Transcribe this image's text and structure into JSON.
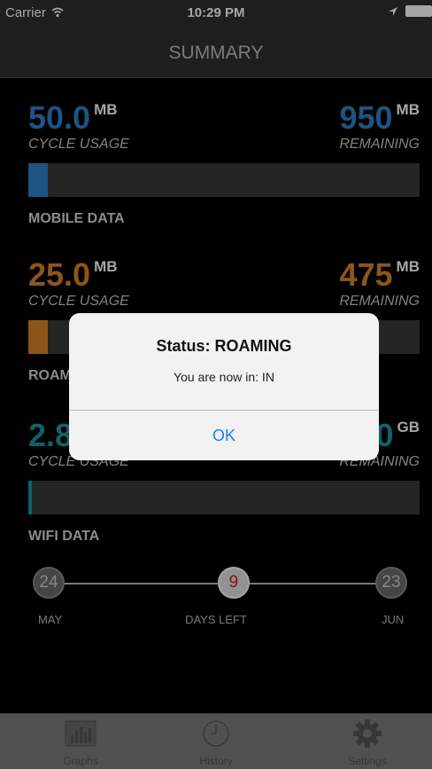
{
  "status_bar": {
    "carrier": "Carrier",
    "time": "10:29 PM"
  },
  "nav": {
    "title": "SUMMARY"
  },
  "sections": [
    {
      "usage_value": "50.0",
      "usage_unit": "MB",
      "usage_label": "CYCLE USAGE",
      "remaining_value": "950",
      "remaining_unit": "MB",
      "remaining_label": "REMAINING",
      "fill_fraction": 0.05,
      "color": "#2f80c8",
      "section_label": "MOBILE DATA"
    },
    {
      "usage_value": "25.0",
      "usage_unit": "MB",
      "usage_label": "CYCLE USAGE",
      "remaining_value": "475",
      "remaining_unit": "MB",
      "remaining_label": "REMAINING",
      "fill_fraction": 0.05,
      "color": "#d88429",
      "section_label": "ROAMING DATA"
    },
    {
      "usage_value": "2.8",
      "usage_unit": "",
      "usage_label": "CYCLE USAGE",
      "remaining_value": "0",
      "remaining_unit": "GB",
      "remaining_label": "REMAINING",
      "fill_fraction": 0.006,
      "color": "#1a96a3",
      "section_label": "WIFI DATA"
    }
  ],
  "timeline": {
    "start_day": "24",
    "start_month": "MAY",
    "today": "9",
    "days_left_label": "DAYS LEFT",
    "end_day": "23",
    "end_month": "JUN",
    "progress_fraction": 0.54
  },
  "alert": {
    "title": "Status: ROAMING",
    "message": "You are now in: IN",
    "button_label": "OK"
  },
  "tabs": [
    {
      "label": "Graphs",
      "icon": "bar-chart-icon"
    },
    {
      "label": "History",
      "icon": "clock-icon"
    },
    {
      "label": "Settings",
      "icon": "gear-icon"
    }
  ]
}
